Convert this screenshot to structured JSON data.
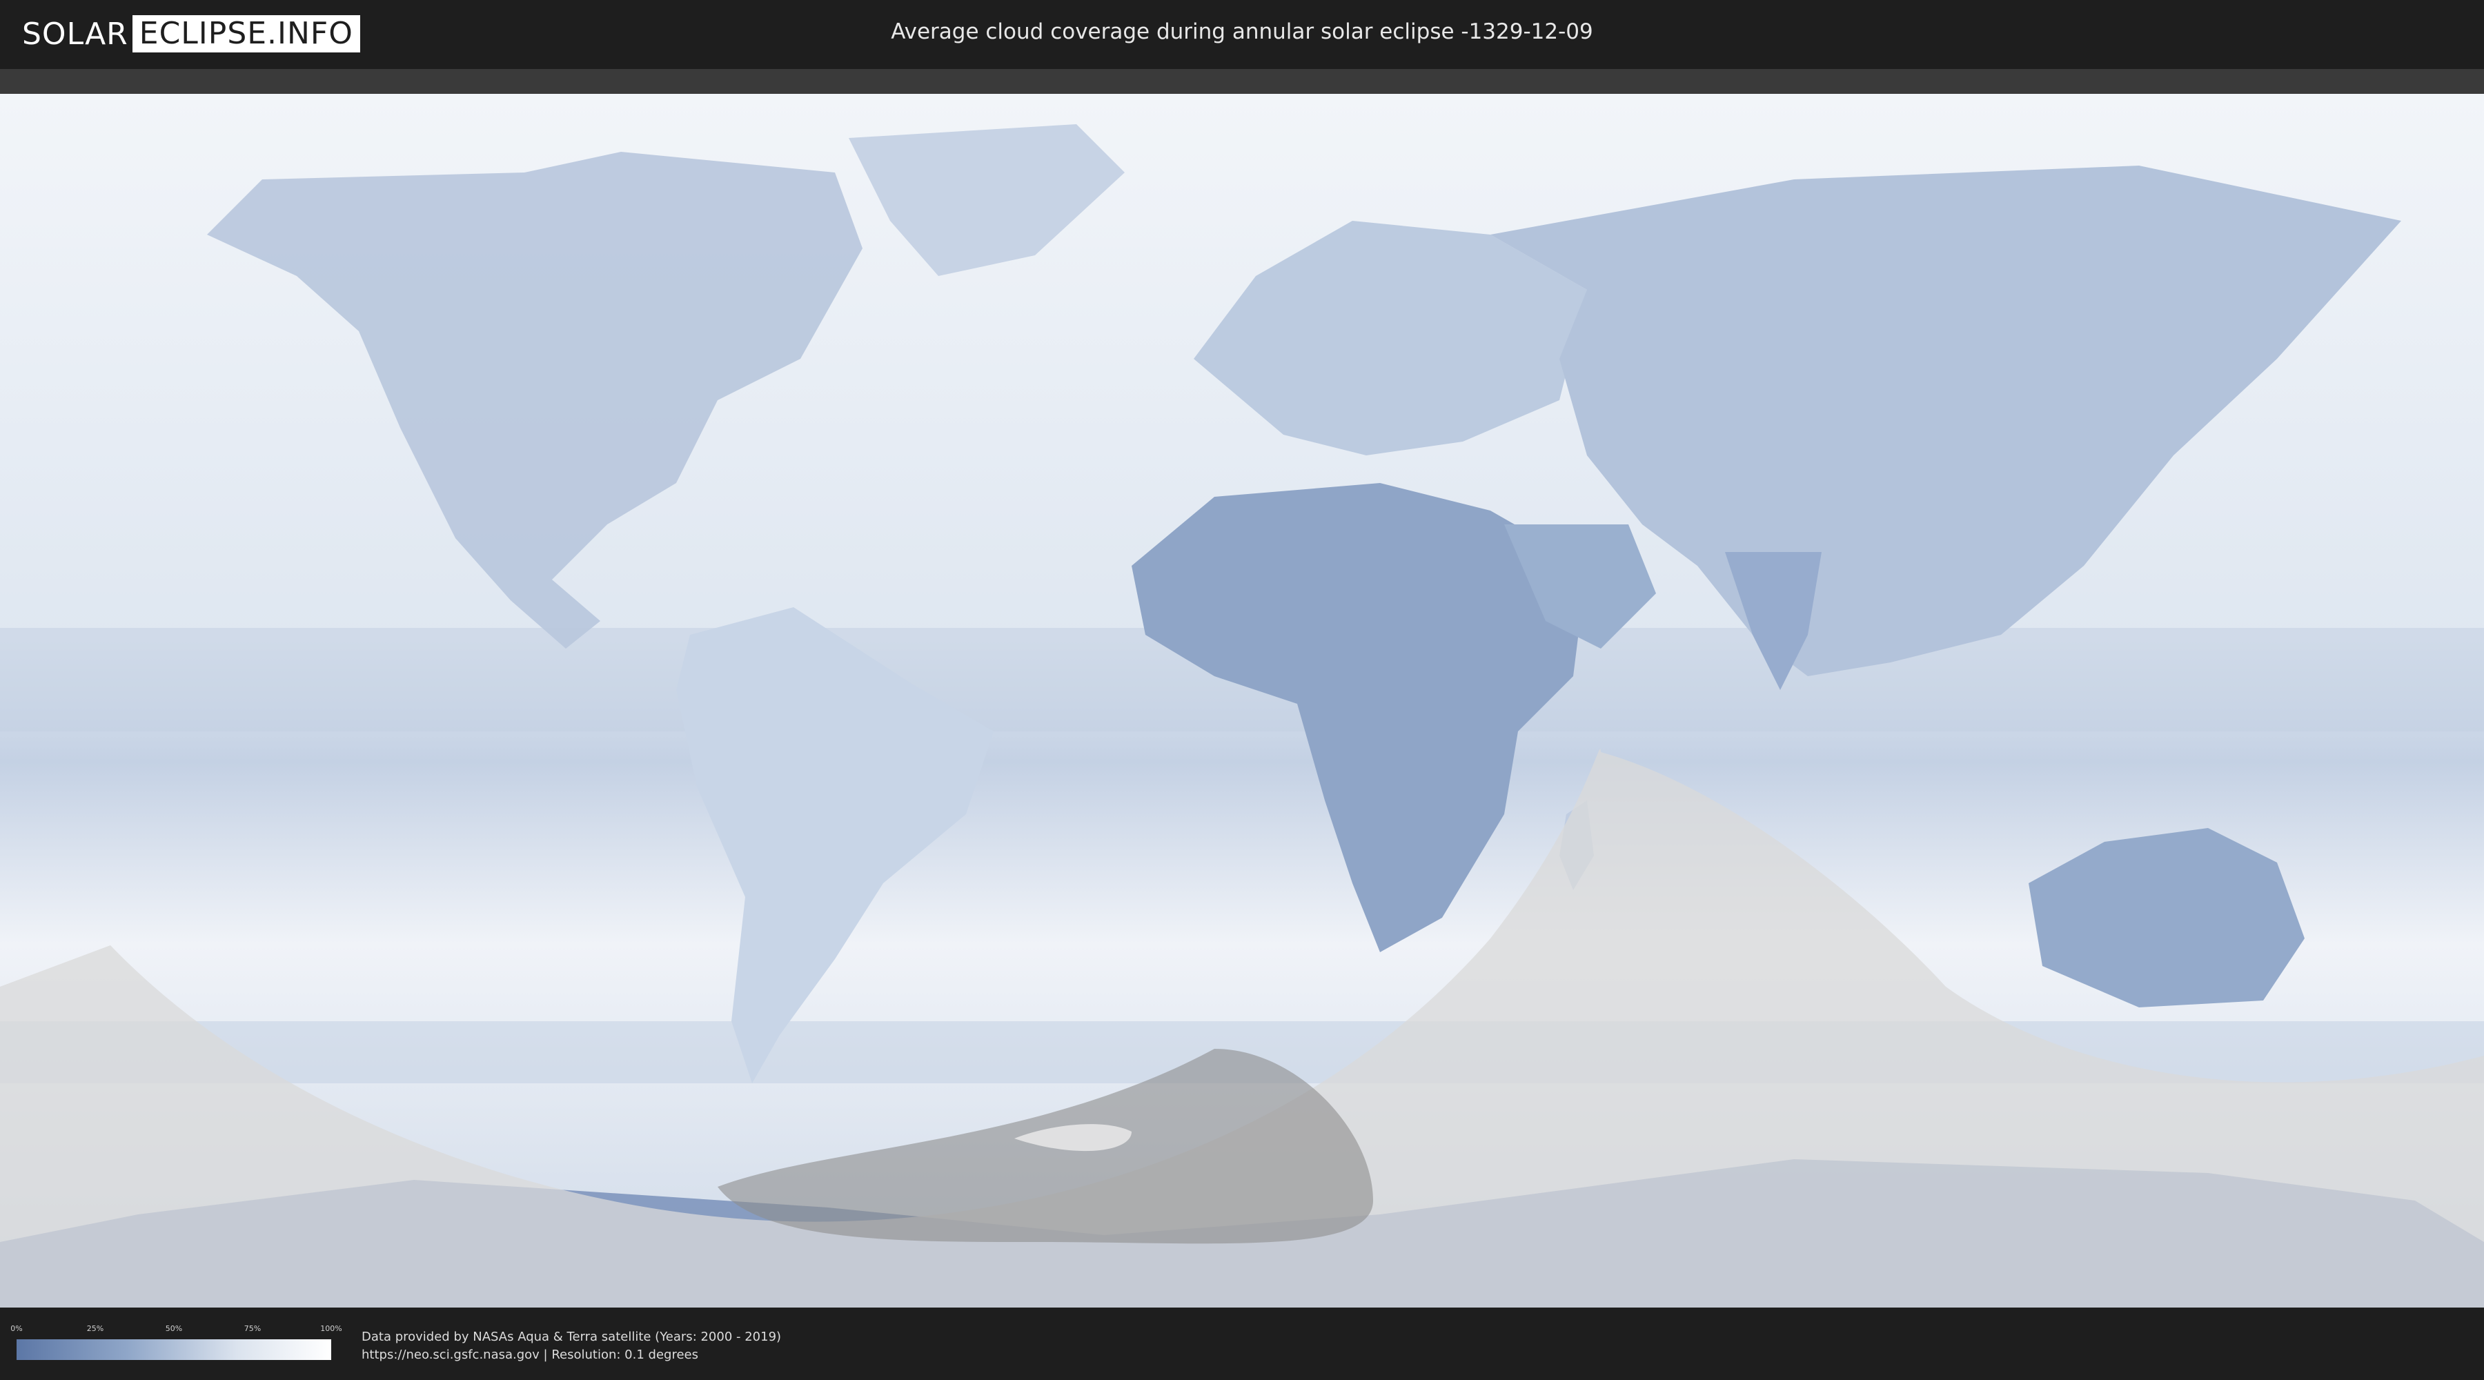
{
  "header": {
    "logo_left": "SOLAR",
    "logo_right": "ECLIPSE.INFO",
    "title": "Average cloud coverage during annular solar eclipse -1329-12-09"
  },
  "map": {
    "subject": "world cloud coverage map with eclipse visibility overlay",
    "colors": {
      "ocean_cloud": "#e9eff6",
      "land_low_cloud": "#8ea4c6",
      "land_mid": "#b7c6dc",
      "shadow_zone": "#9a9a9a",
      "night_overlay": "#d6d6d6"
    }
  },
  "legend": {
    "ticks": [
      "0%",
      "25%",
      "50%",
      "75%",
      "100%"
    ],
    "colors": {
      "low": "#5c77a6",
      "high": "#ffffff"
    }
  },
  "footer": {
    "credit_line_1": "Data provided by NASAs Aqua & Terra satellite (Years: 2000 - 2019)",
    "credit_line_2": "https://neo.sci.gsfc.nasa.gov | Resolution: 0.1 degrees"
  }
}
